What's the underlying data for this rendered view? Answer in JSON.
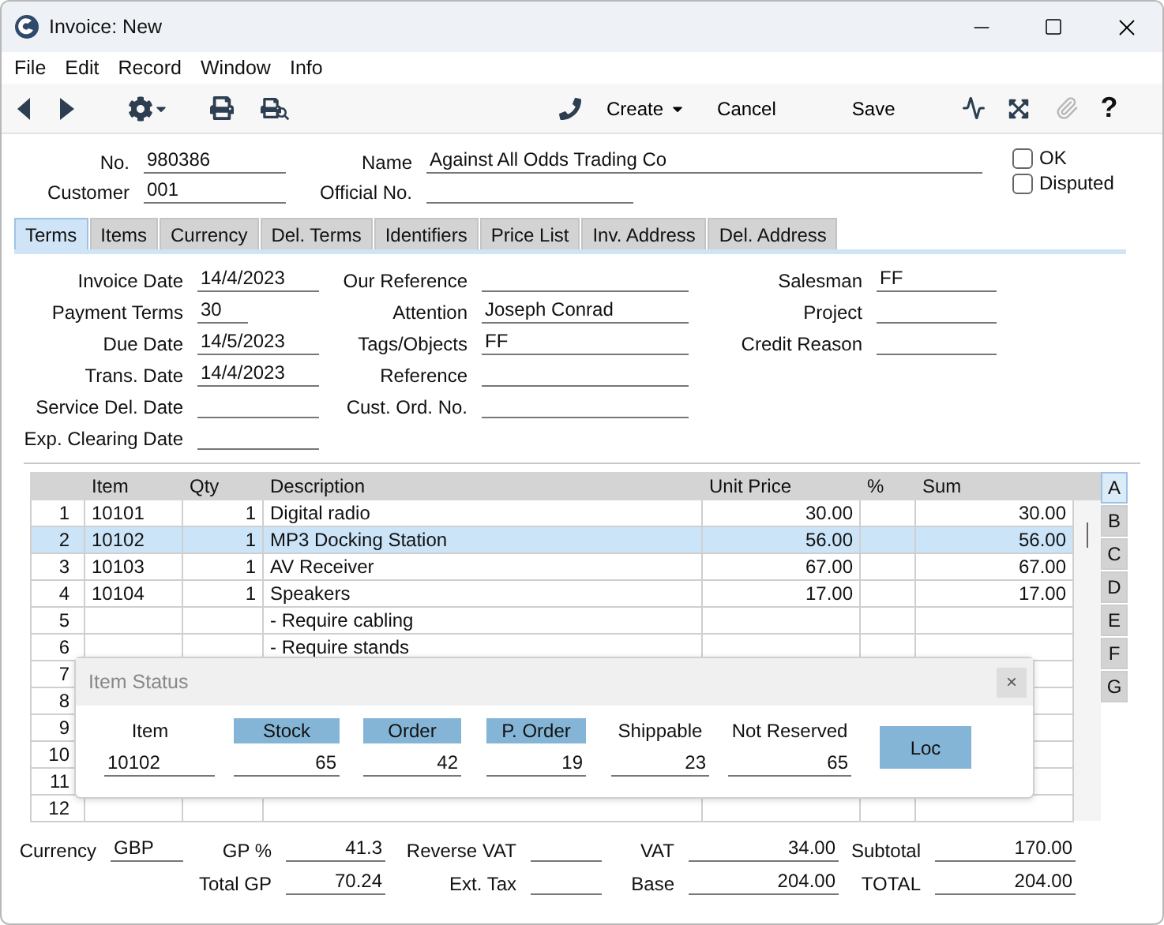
{
  "window": {
    "title": "Invoice: New"
  },
  "menu": [
    "File",
    "Edit",
    "Record",
    "Window",
    "Info"
  ],
  "toolbar": {
    "buttons": [
      {
        "label": "Create",
        "dropdown": true
      },
      {
        "label": "Cancel",
        "dropdown": false
      },
      {
        "label": "Save",
        "dropdown": false
      }
    ],
    "attachment_disabled": true,
    "help": "?"
  },
  "header": {
    "columns": [
      [
        {
          "label": "No.",
          "value": "980386"
        },
        {
          "label": "Customer",
          "value": "001"
        }
      ],
      [
        {
          "label": "Name",
          "value": "Against All Odds Trading Co"
        },
        {
          "label": "Official No."
        }
      ]
    ],
    "checkboxes": [
      {
        "label": "OK",
        "checked": false
      },
      {
        "label": "Disputed",
        "checked": false
      }
    ]
  },
  "tabs": [
    {
      "label": "Terms",
      "selected": true
    },
    {
      "label": "Items",
      "selected": false
    },
    {
      "label": "Currency",
      "selected": false
    },
    {
      "label": "Del. Terms",
      "selected": false
    },
    {
      "label": "Identifiers",
      "selected": false
    },
    {
      "label": "Price List",
      "selected": false
    },
    {
      "label": "Inv. Address",
      "selected": false
    },
    {
      "label": "Del. Address",
      "selected": false
    }
  ],
  "terms": {
    "columns": [
      [
        {
          "label": "Invoice Date",
          "value": "14/4/2023"
        },
        {
          "label": "Payment Terms",
          "value": "30"
        },
        {
          "label": "Due Date",
          "value": "14/5/2023"
        },
        {
          "label": "Trans. Date",
          "value": "14/4/2023"
        },
        {
          "label": "Service Del. Date"
        },
        {
          "label": "Exp. Clearing Date"
        }
      ],
      [
        {
          "label": "Our Reference"
        },
        {
          "label": "Attention",
          "value": "Joseph Conrad"
        },
        {
          "label": "Tags/Objects",
          "value": "FF"
        },
        {
          "label": "Reference"
        },
        {
          "label": "Cust. Ord. No."
        }
      ],
      [
        {
          "label": "Salesman",
          "value": "FF"
        },
        {
          "label": "Project"
        },
        {
          "label": "Credit Reason"
        }
      ]
    ]
  },
  "table": {
    "columns": [
      "Item",
      "Qty",
      "Description",
      "Unit Price",
      "%",
      "Sum"
    ],
    "rows": [
      {
        "number": "1",
        "item": "10101",
        "qty": "1",
        "description": "Digital radio",
        "unit_price": "30.00",
        "sum": "30.00",
        "selected": false
      },
      {
        "number": "2",
        "item": "10102",
        "qty": "1",
        "description": "MP3 Docking Station",
        "unit_price": "56.00",
        "sum": "56.00",
        "selected": true
      },
      {
        "number": "3",
        "item": "10103",
        "qty": "1",
        "description": "AV Receiver",
        "unit_price": "67.00",
        "sum": "67.00",
        "selected": false
      },
      {
        "number": "4",
        "item": "10104",
        "qty": "1",
        "description": "Speakers",
        "unit_price": "17.00",
        "sum": "17.00",
        "selected": false
      },
      {
        "number": "5",
        "description": "- Require cabling",
        "selected": false
      },
      {
        "number": "6",
        "description": "- Require stands",
        "selected": false
      },
      {
        "number": "7",
        "selected": false
      },
      {
        "number": "8",
        "selected": false
      },
      {
        "number": "9",
        "selected": false
      },
      {
        "number": "10",
        "selected": false
      },
      {
        "number": "11",
        "selected": false
      },
      {
        "number": "12",
        "selected": false
      }
    ]
  },
  "side_tabs": [
    {
      "label": "A",
      "selected": true
    },
    {
      "label": "B",
      "selected": false
    },
    {
      "label": "C",
      "selected": false
    },
    {
      "label": "D",
      "selected": false
    },
    {
      "label": "E",
      "selected": false
    },
    {
      "label": "F",
      "selected": false
    },
    {
      "label": "G",
      "selected": false
    }
  ],
  "item_status": {
    "title": "Item Status",
    "close": "×",
    "columns": [
      {
        "label": "Item",
        "value": "10102",
        "kind": "text",
        "highlighted": false
      },
      {
        "label": "Stock",
        "value": "65",
        "kind": "number",
        "highlighted": true
      },
      {
        "label": "Order",
        "value": "42",
        "kind": "number",
        "highlighted": true
      },
      {
        "label": "P. Order",
        "value": "19",
        "kind": "number",
        "highlighted": true
      },
      {
        "label": "Shippable",
        "value": "23",
        "kind": "number",
        "highlighted": false
      },
      {
        "label": "Not Reserved",
        "value": "65",
        "kind": "number",
        "highlighted": false
      }
    ],
    "button": "Loc"
  },
  "footer": {
    "columns": [
      [
        {
          "label": "Currency",
          "value": "GBP",
          "kind": "text"
        }
      ],
      [
        {
          "label": "GP %",
          "value": "41.3",
          "kind": "amount"
        },
        {
          "label": "Total GP",
          "value": "70.24",
          "kind": "amount"
        }
      ],
      [
        {
          "label": "Reverse VAT",
          "kind": "amount"
        },
        {
          "label": "Ext. Tax",
          "kind": "amount"
        }
      ],
      [
        {
          "label": "VAT",
          "value": "34.00",
          "kind": "amount"
        },
        {
          "label": "Base",
          "value": "204.00",
          "kind": "amount"
        }
      ],
      [
        {
          "label": "Subtotal",
          "value": "170.00",
          "kind": "amount"
        },
        {
          "label": "TOTAL",
          "value": "204.00",
          "kind": "amount"
        }
      ]
    ]
  }
}
